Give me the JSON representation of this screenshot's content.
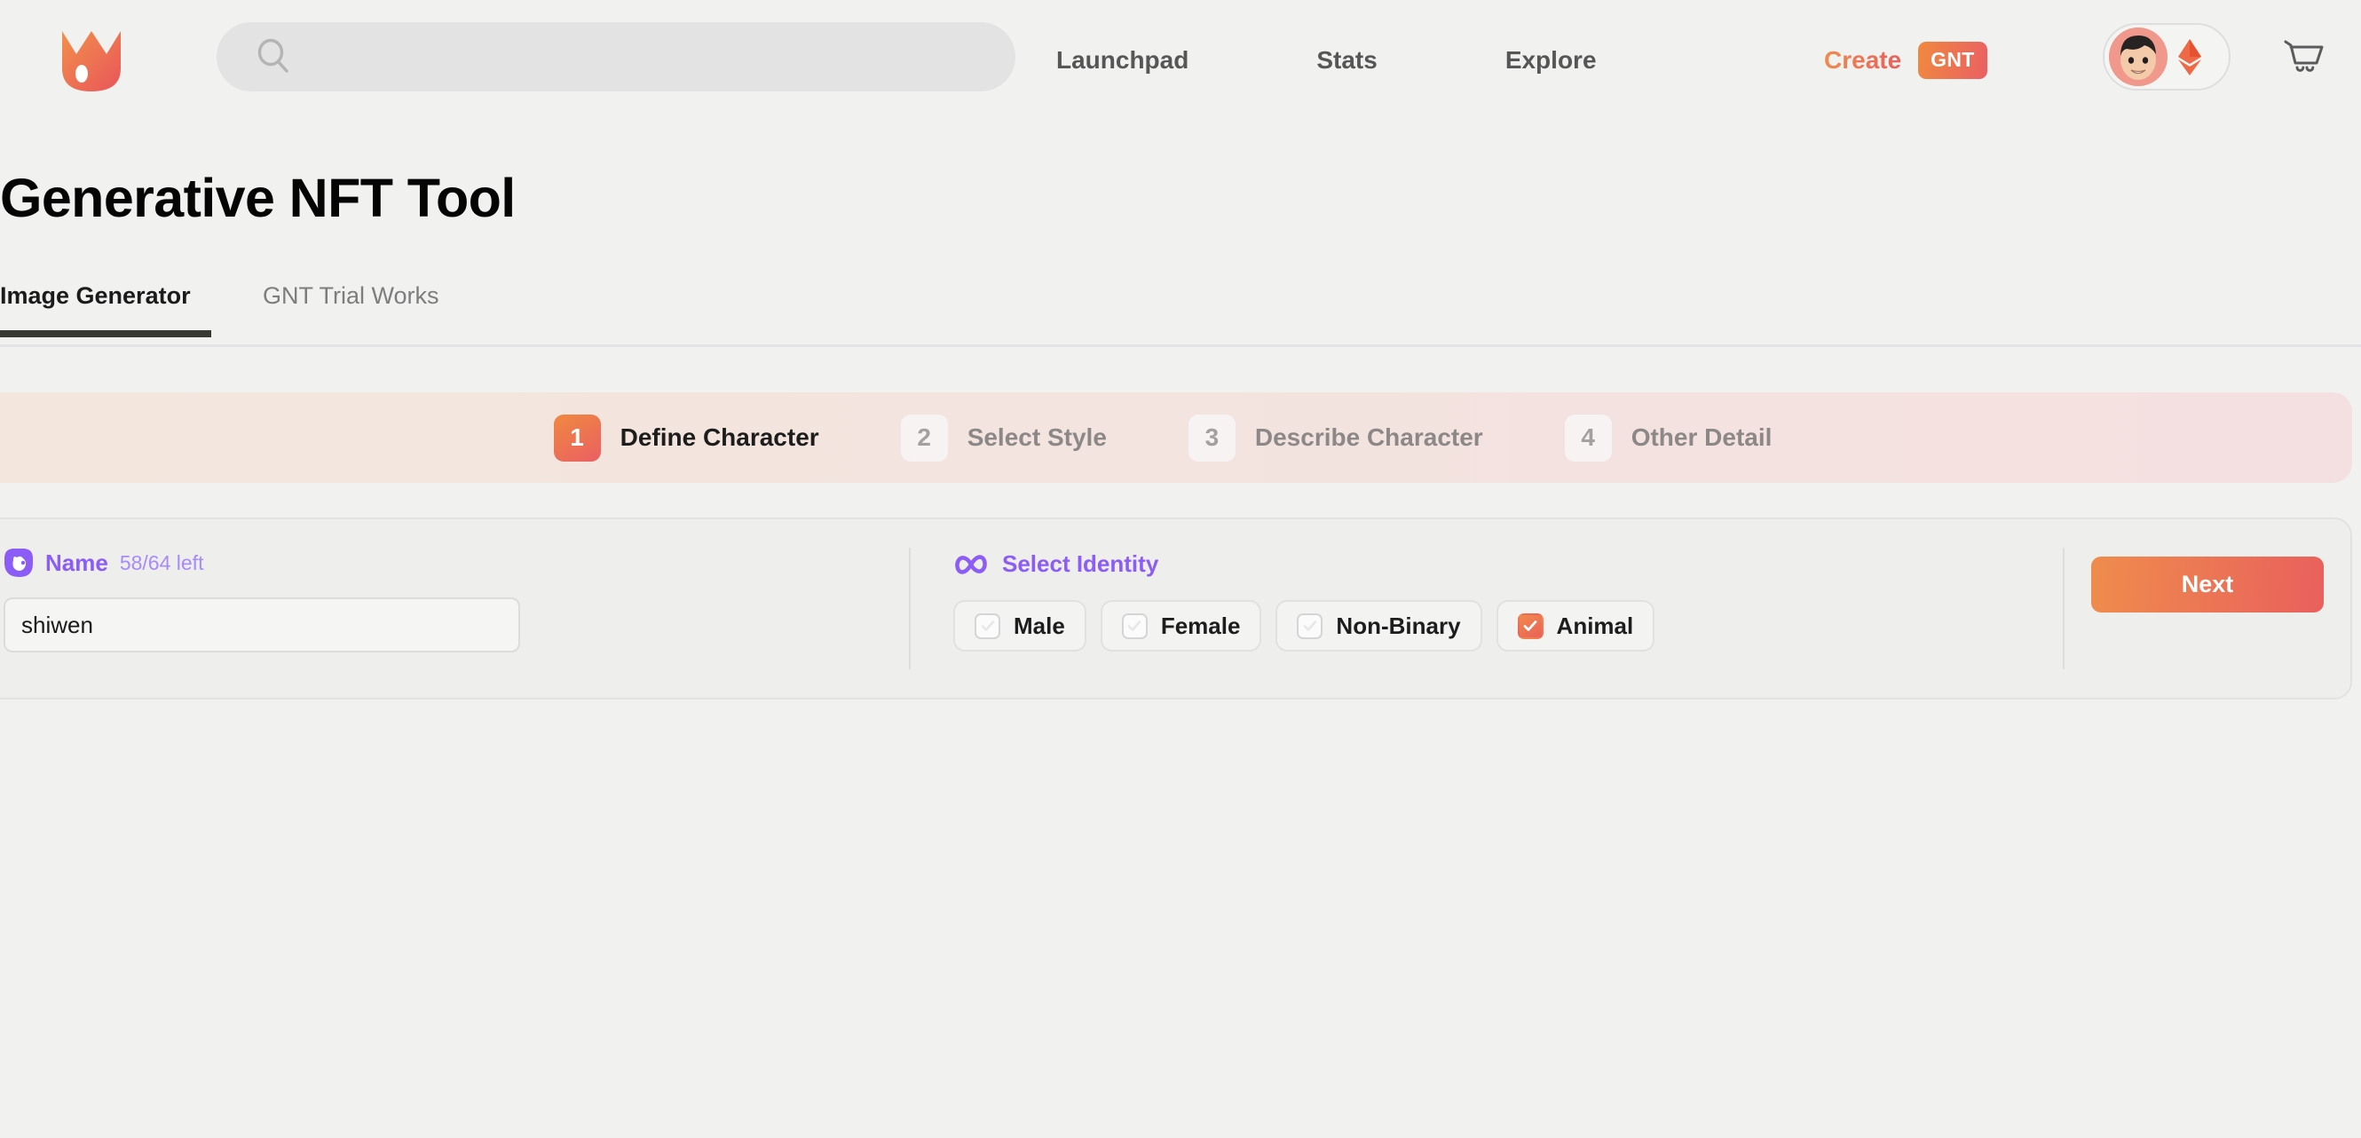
{
  "header": {
    "logo_icon": "fox-logo-icon",
    "search": {
      "value": "",
      "placeholder": "",
      "icon": "search-icon"
    },
    "nav": [
      {
        "id": "launchpad",
        "label": "Launchpad"
      },
      {
        "id": "stats",
        "label": "Stats"
      },
      {
        "id": "explore",
        "label": "Explore"
      }
    ],
    "create": {
      "label": "Create",
      "badge": "GNT"
    },
    "account": {
      "avatar_icon": "user-avatar",
      "currency_icon": "ethereum-icon"
    },
    "cart_icon": "shopping-cart-icon"
  },
  "page": {
    "title": "Generative NFT Tool"
  },
  "tabs": [
    {
      "id": "image-generator",
      "label": "Image Generator",
      "active": true
    },
    {
      "id": "gnt-trial-works",
      "label": "GNT Trial Works",
      "active": false
    }
  ],
  "stepper": {
    "steps": [
      {
        "num": "1",
        "label": "Define Character",
        "active": true
      },
      {
        "num": "2",
        "label": "Select Style",
        "active": false
      },
      {
        "num": "3",
        "label": "Describe Character",
        "active": false
      },
      {
        "num": "4",
        "label": "Other Detail",
        "active": false
      }
    ]
  },
  "form": {
    "name_field": {
      "icon": "pet-face-icon",
      "label": "Name",
      "counter": "58/64 left",
      "value": "shiwen",
      "placeholder": ""
    },
    "identity": {
      "icon": "infinity-icon",
      "label": "Select Identity",
      "options": [
        {
          "id": "male",
          "label": "Male",
          "checked": false
        },
        {
          "id": "female",
          "label": "Female",
          "checked": false
        },
        {
          "id": "non-binary",
          "label": "Non-Binary",
          "checked": false
        },
        {
          "id": "animal",
          "label": "Animal",
          "checked": true
        }
      ]
    },
    "next_button": {
      "label": "Next"
    }
  },
  "colors": {
    "accent_orange": "#f0893f",
    "accent_red": "#ea5f63",
    "purple": "#8b5cf6",
    "purple_light": "#a78bfa",
    "page_bg": "#f1f1f0",
    "stepper_bg_left": "#f3e7dd",
    "stepper_bg_right": "#f4e0e0",
    "tab_underline": "#3a3833"
  }
}
